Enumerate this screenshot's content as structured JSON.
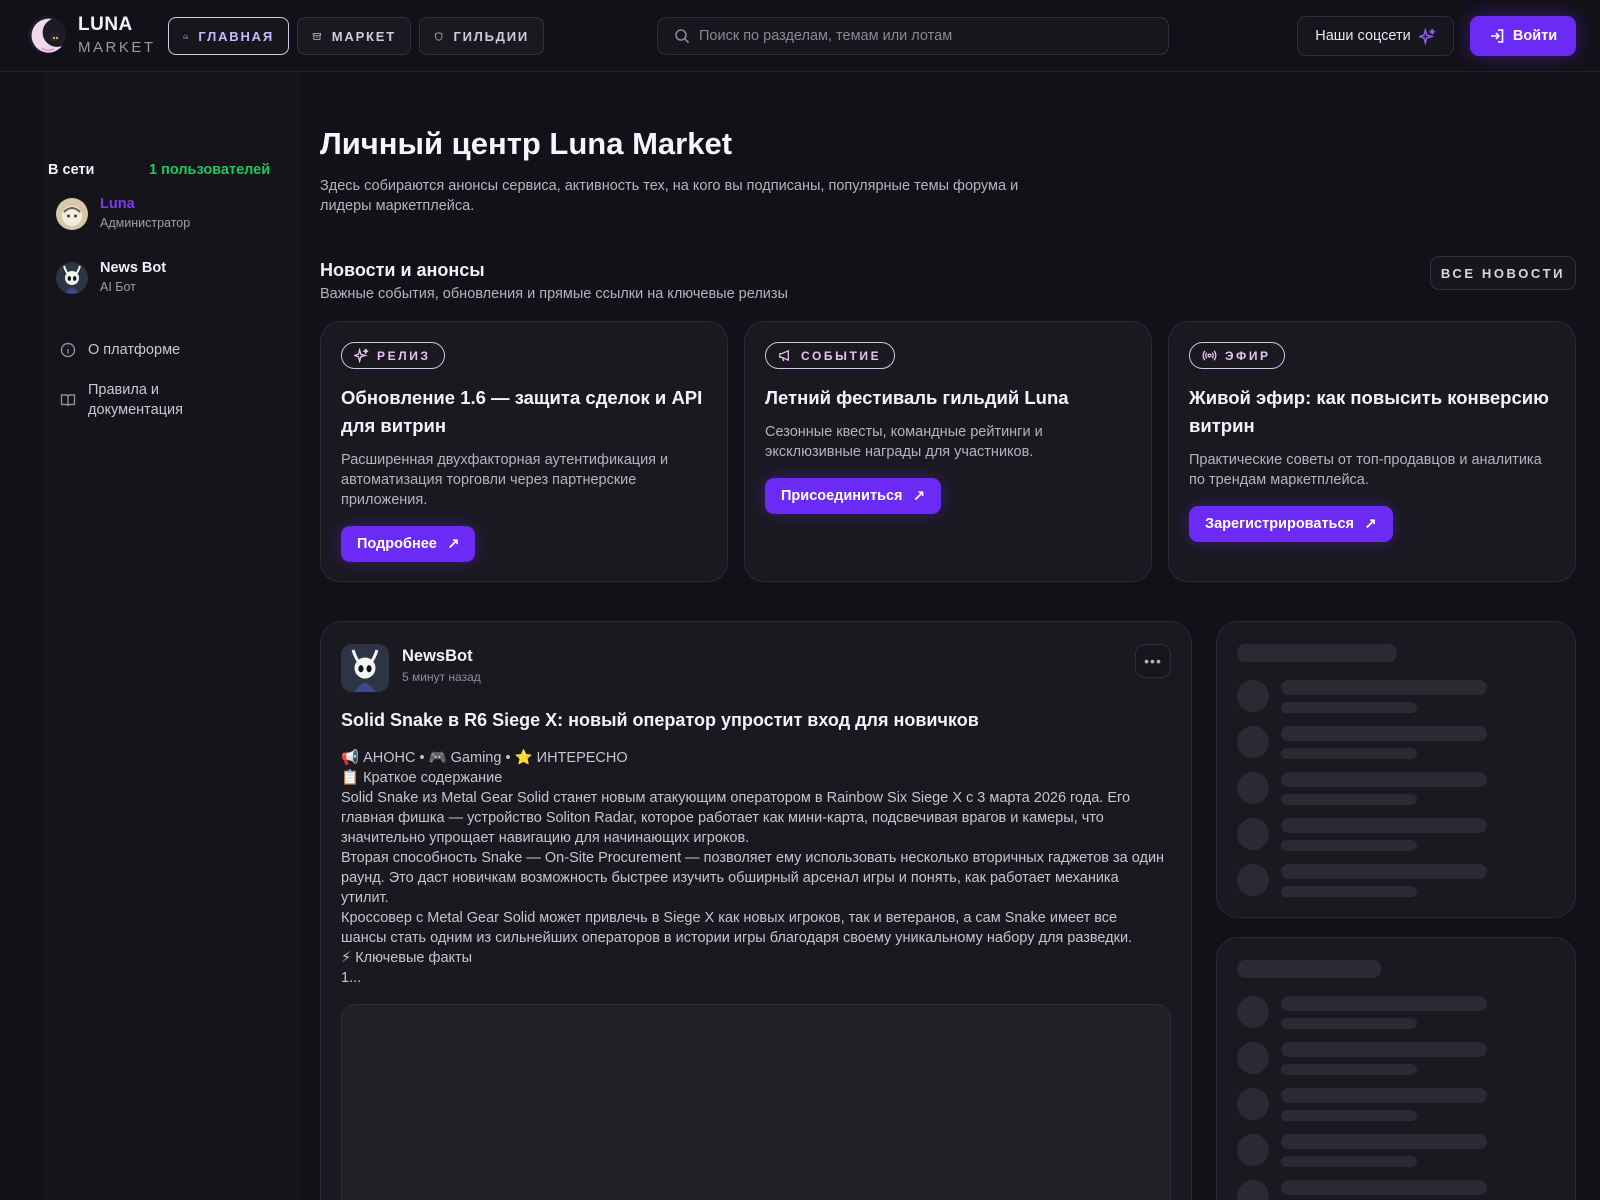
{
  "header": {
    "logo": {
      "line1": "LUNA",
      "line2": "MARKET"
    },
    "nav": [
      {
        "label": "ГЛАВНАЯ",
        "icon": "home-icon",
        "active": true
      },
      {
        "label": "МАРКЕТ",
        "icon": "store-icon",
        "active": false
      },
      {
        "label": "ГИЛЬДИИ",
        "icon": "shield-icon",
        "active": false
      }
    ],
    "search": {
      "placeholder": "Поиск по разделам, темам или лотам",
      "value": ""
    },
    "social_label": "Наши соцсети",
    "login_label": "Войти"
  },
  "sidebar": {
    "online_title": "В сети",
    "online_count": "1 пользователей",
    "users": [
      {
        "name": "Luna",
        "role": "Администратор"
      },
      {
        "name": "News Bot",
        "role": "AI Бот"
      }
    ],
    "links": [
      {
        "label": "О платформе",
        "icon": "info-icon"
      },
      {
        "label": "Правила и документация",
        "icon": "book-icon"
      }
    ]
  },
  "main": {
    "title": "Личный центр Luna Market",
    "description": "Здесь собираются анонсы сервиса, активность тех, на кого вы подписаны, популярные темы форума и лидеры маркетплейса.",
    "news_section": {
      "title": "Новости и анонсы",
      "subtitle": "Важные события, обновления и прямые ссылки на ключевые релизы",
      "all_label": "ВСЕ НОВОСТИ",
      "cards": [
        {
          "tag": "РЕЛИЗ",
          "title": "Обновление 1.6 — защита сделок и API для витрин",
          "text": "Расширенная двухфакторная аутентификация и автоматизация торговли через партнерские приложения.",
          "button": "Подробнее"
        },
        {
          "tag": "СОБЫТИЕ",
          "title": "Летний фестиваль гильдий Luna",
          "text": "Сезонные квесты, командные рейтинги и эксклюзивные награды для участников.",
          "button": "Присоединиться"
        },
        {
          "tag": "ЭФИР",
          "title": "Живой эфир: как повысить конверсию витрин",
          "text": "Практические советы от топ-продавцов и аналитика по трендам маркетплейса.",
          "button": "Зарегистрироваться"
        }
      ]
    },
    "post": {
      "author": "NewsBot",
      "time": "5 минут назад",
      "title": "Solid Snake в R6 Siege X: новый оператор упростит вход для новичков",
      "lines": [
        "📢 АНОНС • 🎮 Gaming  • ⭐ ИНТЕРЕСНО",
        "📋 Краткое содержание",
        "Solid Snake из Metal Gear Solid станет новым атакующим оператором в Rainbow Six Siege X с 3 марта 2026 года. Его главная фишка — устройство Soliton Radar, которое работает как мини-карта, подсвечивая врагов и камеры, что значительно упрощает навигацию для начинающих игроков.",
        "Вторая способность Snake — On-Site Procurement — позволяет ему использовать несколько вторичных гаджетов за один раунд. Это даст новичкам возможность быстрее изучить обширный арсенал игры и понять, как работает механика утилит.",
        "Кроссовер с Metal Gear Solid может привлечь в Siege X как новых игроков, так и ветеранов, а сам Snake имеет все шансы стать одним из сильнейших операторов в истории игры благодаря своему уникальному набору для разведки.",
        "⚡ Ключевые факты",
        "1..."
      ]
    }
  },
  "colors": {
    "accent": "#6c2bf5",
    "online": "#22c55e",
    "admin": "#7c3aed",
    "background": "#121117"
  }
}
